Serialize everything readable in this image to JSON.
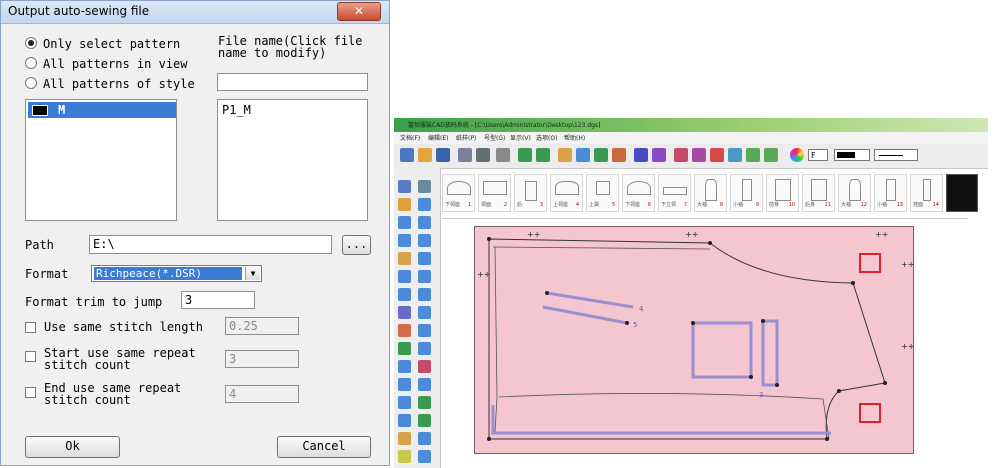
{
  "dialog": {
    "title": "Output auto-sewing file",
    "close_label": "✕",
    "radio_options": [
      {
        "label": "Only select pattern",
        "selected": true
      },
      {
        "label": "All patterns in view",
        "selected": false
      },
      {
        "label": "All patterns of style",
        "selected": false
      }
    ],
    "file_name_label": "File name(Click file name to modify)",
    "file_name_input": "",
    "pattern_list": [
      {
        "label": "M",
        "color": "#000000",
        "selected": true
      }
    ],
    "file_list": [
      "P1_M"
    ],
    "path_label": "Path",
    "path_value": "E:\\",
    "browse_label": "...",
    "format_label": "Format",
    "format_value": "Richpeace(*.DSR)",
    "trim_label": "Format trim to jump",
    "trim_value": "3",
    "same_stitch_label": "Use same stitch length",
    "same_stitch_value": "0.25",
    "start_repeat_label_1": "Start use same repeat",
    "start_repeat_label_2": "stitch count",
    "start_repeat_value": "3",
    "end_repeat_label_1": "End use same repeat",
    "end_repeat_label_2": "stitch count",
    "end_repeat_value": "4",
    "ok_label": "Ok",
    "cancel_label": "Cancel"
  },
  "cad": {
    "title": "富怡服装CAD放码系统 - [C:\\Users\\Administrator\\Desktop\\123.dgs]",
    "menu": [
      "文档(F)",
      "编辑(E)",
      "纸样(P)",
      "号型(G)",
      "显示(V)",
      "选项(O)",
      "帮助(H)"
    ],
    "toolbar_line_label": "F",
    "thumbnails": [
      {
        "label": "下领座",
        "num": "1"
      },
      {
        "label": "领面",
        "num": "2"
      },
      {
        "label": "后",
        "num": "3"
      },
      {
        "label": "上领座",
        "num": "4"
      },
      {
        "label": "上袋",
        "num": "5"
      },
      {
        "label": "下领座",
        "num": "6"
      },
      {
        "label": "下立领",
        "num": "7"
      },
      {
        "label": "大袖",
        "num": "8"
      },
      {
        "label": "小袖",
        "num": "9"
      },
      {
        "label": "前身",
        "num": "10"
      },
      {
        "label": "后身",
        "num": "11"
      },
      {
        "label": "大袖",
        "num": "12"
      },
      {
        "label": "小袖",
        "num": "13"
      },
      {
        "label": "挂面",
        "num": "14"
      }
    ],
    "canvas_labels": [
      "4",
      "5",
      "3"
    ],
    "canvas_color": "#f4c6cf",
    "accent_red": "#e0202a",
    "stitch_color": "#9a8fd0"
  }
}
